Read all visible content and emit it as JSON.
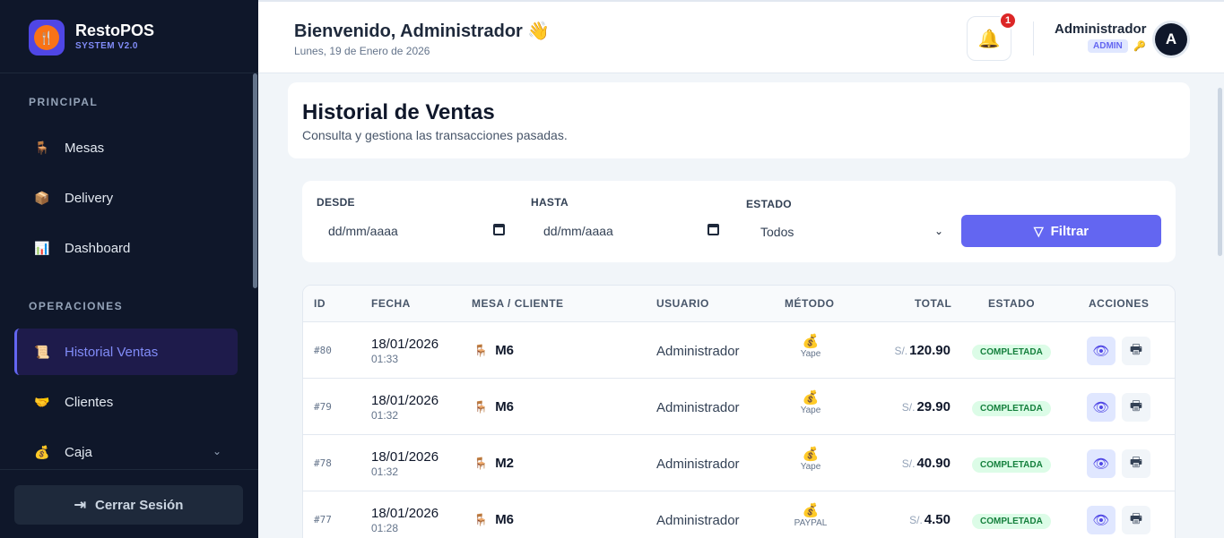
{
  "brand": {
    "name": "RestoPOS",
    "subtitle": "SYSTEM V2.0"
  },
  "sidebar": {
    "sections": [
      {
        "title": "PRINCIPAL"
      },
      {
        "title": "OPERACIONES"
      }
    ],
    "items": [
      {
        "label": "Mesas",
        "icon": "chair-icon"
      },
      {
        "label": "Delivery",
        "icon": "package-icon"
      },
      {
        "label": "Dashboard",
        "icon": "bar-chart-icon"
      },
      {
        "label": "Historial Ventas",
        "icon": "scroll-icon",
        "active": true
      },
      {
        "label": "Clientes",
        "icon": "handshake-icon"
      },
      {
        "label": "Caja",
        "icon": "money-bag-icon",
        "expandable": true
      }
    ],
    "logout_label": "Cerrar Sesión"
  },
  "header": {
    "welcome": "Bienvenido, Administrador 👋",
    "date": "Lunes, 19 de Enero de 2026",
    "notification_count": "1",
    "user_name": "Administrador",
    "user_role": "ADMIN",
    "avatar_initial": "A"
  },
  "page": {
    "title": "Historial de Ventas",
    "subtitle": "Consulta y gestiona las transacciones pasadas."
  },
  "filters": {
    "from_label": "DESDE",
    "from_placeholder": "dd/mm/aaaa",
    "to_label": "HASTA",
    "to_placeholder": "dd/mm/aaaa",
    "status_label": "ESTADO",
    "status_value": "Todos",
    "button_label": "Filtrar"
  },
  "table": {
    "columns": [
      "ID",
      "FECHA",
      "MESA / CLIENTE",
      "USUARIO",
      "MÉTODO",
      "TOTAL",
      "ESTADO",
      "ACCIONES"
    ],
    "currency": "S/.",
    "rows": [
      {
        "id": "#80",
        "date": "18/01/2026",
        "time": "01:33",
        "mesa": "M6",
        "user": "Administrador",
        "method": "Yape",
        "total": "120.90",
        "status": "COMPLETADA"
      },
      {
        "id": "#79",
        "date": "18/01/2026",
        "time": "01:32",
        "mesa": "M6",
        "user": "Administrador",
        "method": "Yape",
        "total": "29.90",
        "status": "COMPLETADA"
      },
      {
        "id": "#78",
        "date": "18/01/2026",
        "time": "01:32",
        "mesa": "M2",
        "user": "Administrador",
        "method": "Yape",
        "total": "40.90",
        "status": "COMPLETADA"
      },
      {
        "id": "#77",
        "date": "18/01/2026",
        "time": "01:28",
        "mesa": "M6",
        "user": "Administrador",
        "method": "PAYPAL",
        "total": "4.50",
        "status": "COMPLETADA"
      }
    ]
  },
  "colors": {
    "accent": "#6366f1",
    "sidebar_bg": "#0f172a",
    "status_completed": "#15803d"
  }
}
